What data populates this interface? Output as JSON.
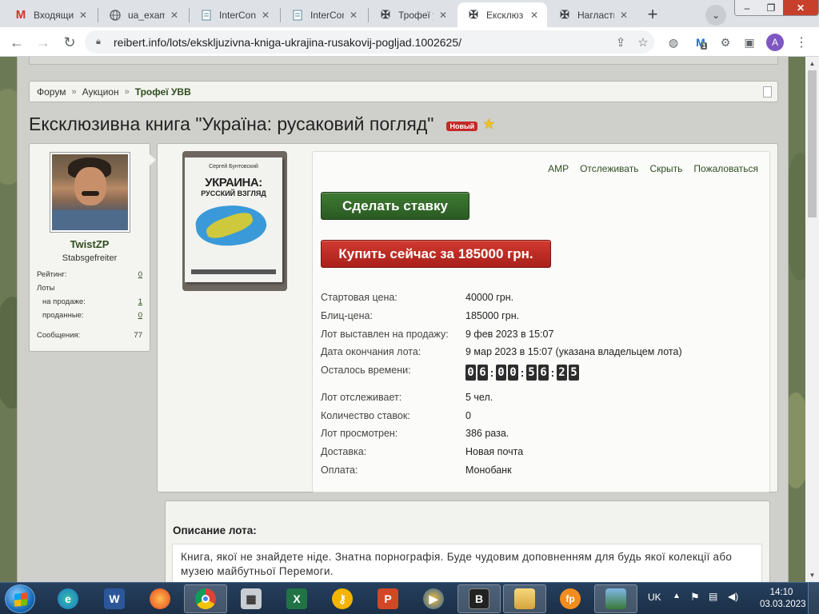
{
  "browser": {
    "tabs": [
      {
        "label": "Входящи",
        "icon": "gmail-icon",
        "active": false
      },
      {
        "label": "ua_examp",
        "icon": "globe-icon",
        "active": false
      },
      {
        "label": "InterConti",
        "icon": "document-icon",
        "active": false
      },
      {
        "label": "InterConti",
        "icon": "document-icon",
        "active": false
      },
      {
        "label": "Трофеї у",
        "icon": "iron-cross-icon",
        "active": false
      },
      {
        "label": "Ексклюз",
        "icon": "iron-cross-icon",
        "active": true
      },
      {
        "label": "Нагласть",
        "icon": "iron-cross-icon",
        "active": false
      }
    ],
    "new_tab": "+",
    "url": "reibert.info/lots/ekskljuzivna-kniga-ukrajina-rusakovij-pogljad.1002625/",
    "profile_initial": "A",
    "ext_badge": "1"
  },
  "breadcrumb": {
    "items": [
      "Форум",
      "Аукцион"
    ],
    "current": "Трофеї УВВ",
    "separator": "»"
  },
  "page": {
    "title": "Ексклюзивна книга \"Україна: русаковий погляд\"",
    "badge": "Новый",
    "star": "★"
  },
  "user": {
    "name": "TwistZP",
    "rank": "Stabsgefreiter",
    "stats": [
      {
        "label": "Рейтинг:",
        "value": "0",
        "link": true
      },
      {
        "label": "Лоты",
        "value": "",
        "link": false
      },
      {
        "label": "на продаже:",
        "value": "1",
        "link": true,
        "indent": true
      },
      {
        "label": "проданные:",
        "value": "0",
        "link": true,
        "indent": true
      },
      {
        "label": "Сообщения:",
        "value": "77",
        "link": false
      }
    ]
  },
  "book_cover": {
    "author": "Сергей Бунтовский",
    "title": "УКРАИНА:",
    "subtitle": "РУССКИЙ ВЗГЛЯД"
  },
  "lot": {
    "actions": [
      "АМР",
      "Отслеживать",
      "Скрыть",
      "Пожаловаться"
    ],
    "bid_button": "Сделать ставку",
    "buy_button": "Купить сейчас за 185000 грн.",
    "details": [
      {
        "label": "Стартовая цена:",
        "value": "40000 грн."
      },
      {
        "label": "Блиц-цена:",
        "value": "185000 грн."
      },
      {
        "label": "Лот выставлен на продажу:",
        "value": "9 фев 2023 в 15:07"
      },
      {
        "label": "Дата окончания лота:",
        "value": "9 мар 2023 в 15:07 (указана владельцем лота)"
      }
    ],
    "time_left_label": "Осталось времени:",
    "time_left": [
      "06",
      "00",
      "56",
      "25"
    ],
    "details2": [
      {
        "label": "Лот отслеживает:",
        "value": "5 чел."
      },
      {
        "label": "Количество ставок:",
        "value": "0"
      },
      {
        "label": "Лот просмотрен:",
        "value": "386 раза."
      },
      {
        "label": "Доставка:",
        "value": "Новая почта"
      },
      {
        "label": "Оплата:",
        "value": "Монобанк"
      }
    ]
  },
  "description": {
    "heading": "Описание лота:",
    "text": "Книга, якої не знайдете ніде. Знатна порнографія. Буде чудовим доповненням для будь якої колекції або музею майбутньої Перемоги."
  },
  "taskbar": {
    "lang": "UK",
    "time": "14:10",
    "date": "03.03.2023"
  }
}
